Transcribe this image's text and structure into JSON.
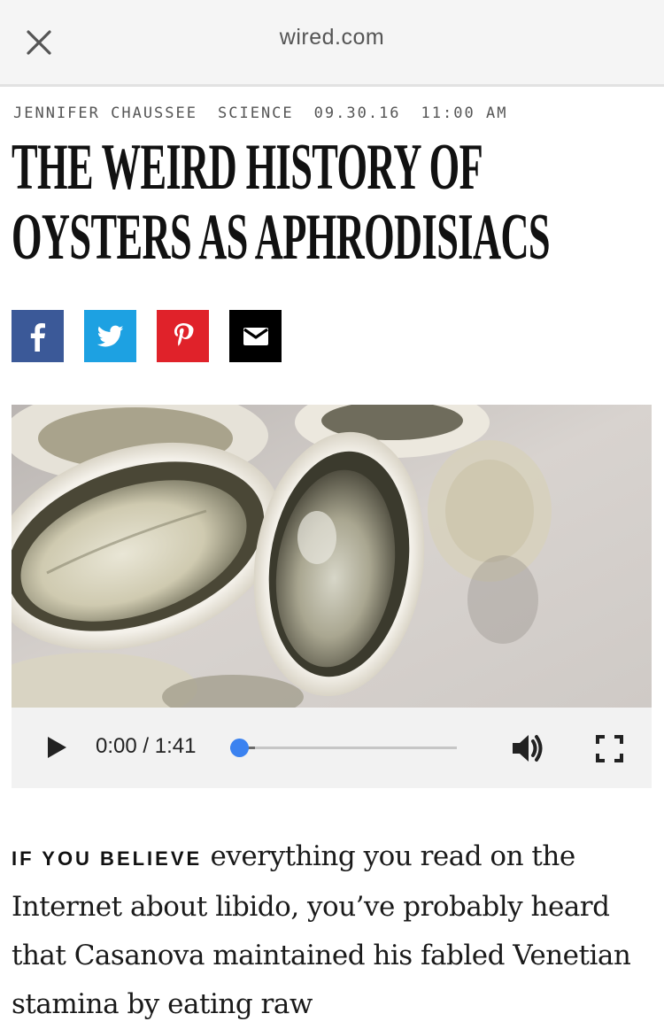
{
  "browser": {
    "url": "wired.com",
    "close_icon": "close-icon"
  },
  "article": {
    "author": "JENNIFER CHAUSSEE",
    "category": "SCIENCE",
    "date": "09.30.16",
    "time": "11:00 AM",
    "headline_line1": "THE WEIRD HISTORY OF",
    "headline_line2": "OYSTERS AS APHRODISIACS",
    "lead_in": "IF YOU BELIEVE",
    "body": "everything you read on the Internet about libido, you’ve probably heard that Casanova maintained his fabled Venetian stamina by eating raw"
  },
  "share": {
    "icons": [
      "facebook-icon",
      "twitter-icon",
      "pinterest-icon",
      "email-icon"
    ],
    "colors": {
      "facebook": "#3b5998",
      "twitter": "#1da1e2",
      "pinterest": "#e0222a",
      "email": "#000000"
    }
  },
  "player": {
    "current_time": "0:00",
    "separator": " / ",
    "duration": "1:41",
    "progress": 0.0,
    "accent_color": "#3b82f0",
    "icons": [
      "play-icon",
      "volume-icon",
      "fullscreen-icon"
    ]
  }
}
